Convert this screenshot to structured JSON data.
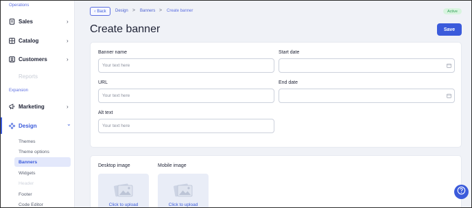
{
  "sidebar": {
    "sections": {
      "operations": "Operations",
      "expansion": "Expansion"
    },
    "items": {
      "sales": {
        "label": "Sales",
        "icon": "document-icon"
      },
      "catalog": {
        "label": "Catalog",
        "icon": "catalog-icon"
      },
      "customers": {
        "label": "Customers",
        "icon": "users-icon"
      },
      "reports": {
        "label": "Reports",
        "icon": ""
      },
      "marketing": {
        "label": "Marketing",
        "icon": "megaphone-icon"
      },
      "design": {
        "label": "Design",
        "icon": "design-icon"
      }
    },
    "design_submenu": [
      "Themes",
      "Theme options",
      "Banners",
      "Widgets",
      "Header",
      "Footer",
      "Code Editor"
    ],
    "chevron_right": "›",
    "chevron_down": "⌄"
  },
  "header": {
    "back_label": "Back",
    "breadcrumb": [
      "Design",
      "Banners",
      "Create banner"
    ],
    "separator": ">",
    "status": "Active",
    "title": "Create banner",
    "save_label": "Save"
  },
  "form": {
    "banner_name": {
      "label": "Banner name",
      "placeholder": "Your text here"
    },
    "start_date": {
      "label": "Start date",
      "value": ""
    },
    "url": {
      "label": "URL",
      "placeholder": "Your text here"
    },
    "end_date": {
      "label": "End date",
      "value": ""
    },
    "alt_text": {
      "label": "Alt text",
      "placeholder": "Your text here"
    }
  },
  "images": {
    "desktop": {
      "label": "Desktop image",
      "upload": "Click to upload"
    },
    "mobile": {
      "label": "Mobile image",
      "upload": "Click to upload"
    }
  },
  "colors": {
    "accent": "#3b5bdb",
    "active_badge_bg": "#d8f4df",
    "active_badge_text": "#2f9e55"
  }
}
